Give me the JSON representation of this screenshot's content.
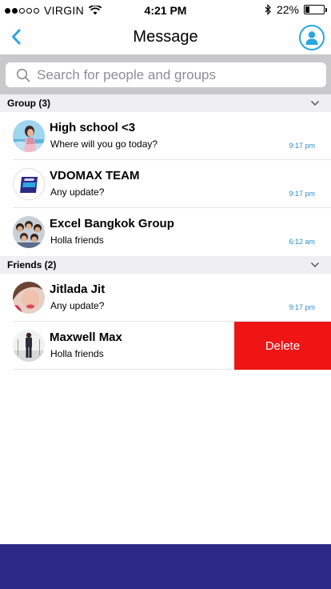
{
  "status_bar": {
    "carrier": "VIRGIN",
    "time": "4:21 PM",
    "battery_text": "22%",
    "battery_level": 0.22,
    "signal_bars_filled": 2,
    "signal_bars_total": 5
  },
  "nav": {
    "title": "Message",
    "accent_color": "#2aa7df"
  },
  "search": {
    "placeholder": "Search for people and groups",
    "value": ""
  },
  "sections": [
    {
      "label": "Group (3)",
      "items": [
        {
          "name": "High school <3",
          "message": "Where will you go today?",
          "time": "9:17 pm",
          "avatar": "girl-beach-photo"
        },
        {
          "name": "VDOMAX TEAM",
          "message": "Any update?",
          "time": "9:17 pm",
          "avatar": "vdomax-logo"
        },
        {
          "name": "Excel Bangkok Group",
          "message": "Holla friends",
          "time": "6:12 am",
          "avatar": "group-photo"
        }
      ]
    },
    {
      "label": "Friends (2)",
      "items": [
        {
          "name": "Jitlada Jit",
          "message": "Any update?",
          "time": "9:17 pm",
          "avatar": "girl-selfie-photo"
        },
        {
          "name": "Maxwell Max",
          "message": "Holla friends",
          "time": "",
          "avatar": "man-photo",
          "swipe_action": "Delete"
        }
      ]
    }
  ],
  "colors": {
    "time_text": "#2b8ecf",
    "delete": "#ef1515",
    "bottom_bar": "#2d2a87"
  }
}
